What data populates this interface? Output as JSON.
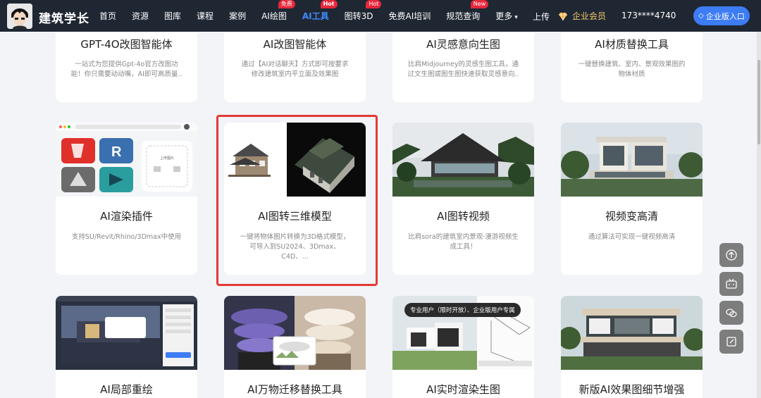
{
  "header": {
    "brand": "建筑学长",
    "nav": [
      {
        "label": "首页"
      },
      {
        "label": "资源"
      },
      {
        "label": "图库"
      },
      {
        "label": "课程"
      },
      {
        "label": "案例"
      },
      {
        "label": "AI绘图",
        "badge": "免费"
      },
      {
        "label": "AI工具",
        "badge": "Hot",
        "active": true
      },
      {
        "label": "图转3D",
        "badge": "Hot"
      },
      {
        "label": "免费AI培训"
      },
      {
        "label": "规范查询",
        "badge": "New"
      },
      {
        "label": "更多"
      }
    ],
    "upload": "上传",
    "vip": "企业会员",
    "phone": "173****4740",
    "enterprise": "企业版入口"
  },
  "cards": [
    {
      "title": "GPT-4O改图智能体",
      "desc": "一站式为您提供Gpt-4o官方改图功能！你只需要动动嘴，AI即可高质量.."
    },
    {
      "title": "AI改图智能体",
      "desc": "通过【AI对话聊天】方式即可按要求修改建筑室内平立面及效果图"
    },
    {
      "title": "AI灵感意向生图",
      "desc": "比肩Midjourney的灵感生图工具，通过文生图或图生图快速获取灵感意向.."
    },
    {
      "title": "AI材质替换工具",
      "desc": "一键替换建筑、室内、景观效果图的物体材质"
    },
    {
      "title": "AI渲染插件",
      "desc": "支持SU/Revit/Rhino/3Dmax中使用",
      "plugin_upload": "上传图片"
    },
    {
      "title": "AI图转三维模型",
      "desc": "一键将物体图片转换为3D格式模型，可导入到SU2024、3Dmax、C4D、..."
    },
    {
      "title": "AI图转视频",
      "desc": "比肩sora的建筑室内景观·漫游视频生成工具！"
    },
    {
      "title": "视频变高清",
      "desc": "通过算法可实现一键视频高清"
    },
    {
      "title": "AI局部重绘",
      "desc": ""
    },
    {
      "title": "AI万物迁移替换工具",
      "desc": ""
    },
    {
      "title": "AI实时渲染生图",
      "desc": "",
      "chip": "专业用户（限时开放）、企业版用户专属"
    },
    {
      "title": "新版AI效果图细节增强",
      "desc": ""
    }
  ],
  "colors": {
    "header_bg": "#1f2733",
    "accent": "#3f8cff",
    "badge": "#e8273b",
    "highlight": "#e53935",
    "vip": "#f3c969"
  }
}
